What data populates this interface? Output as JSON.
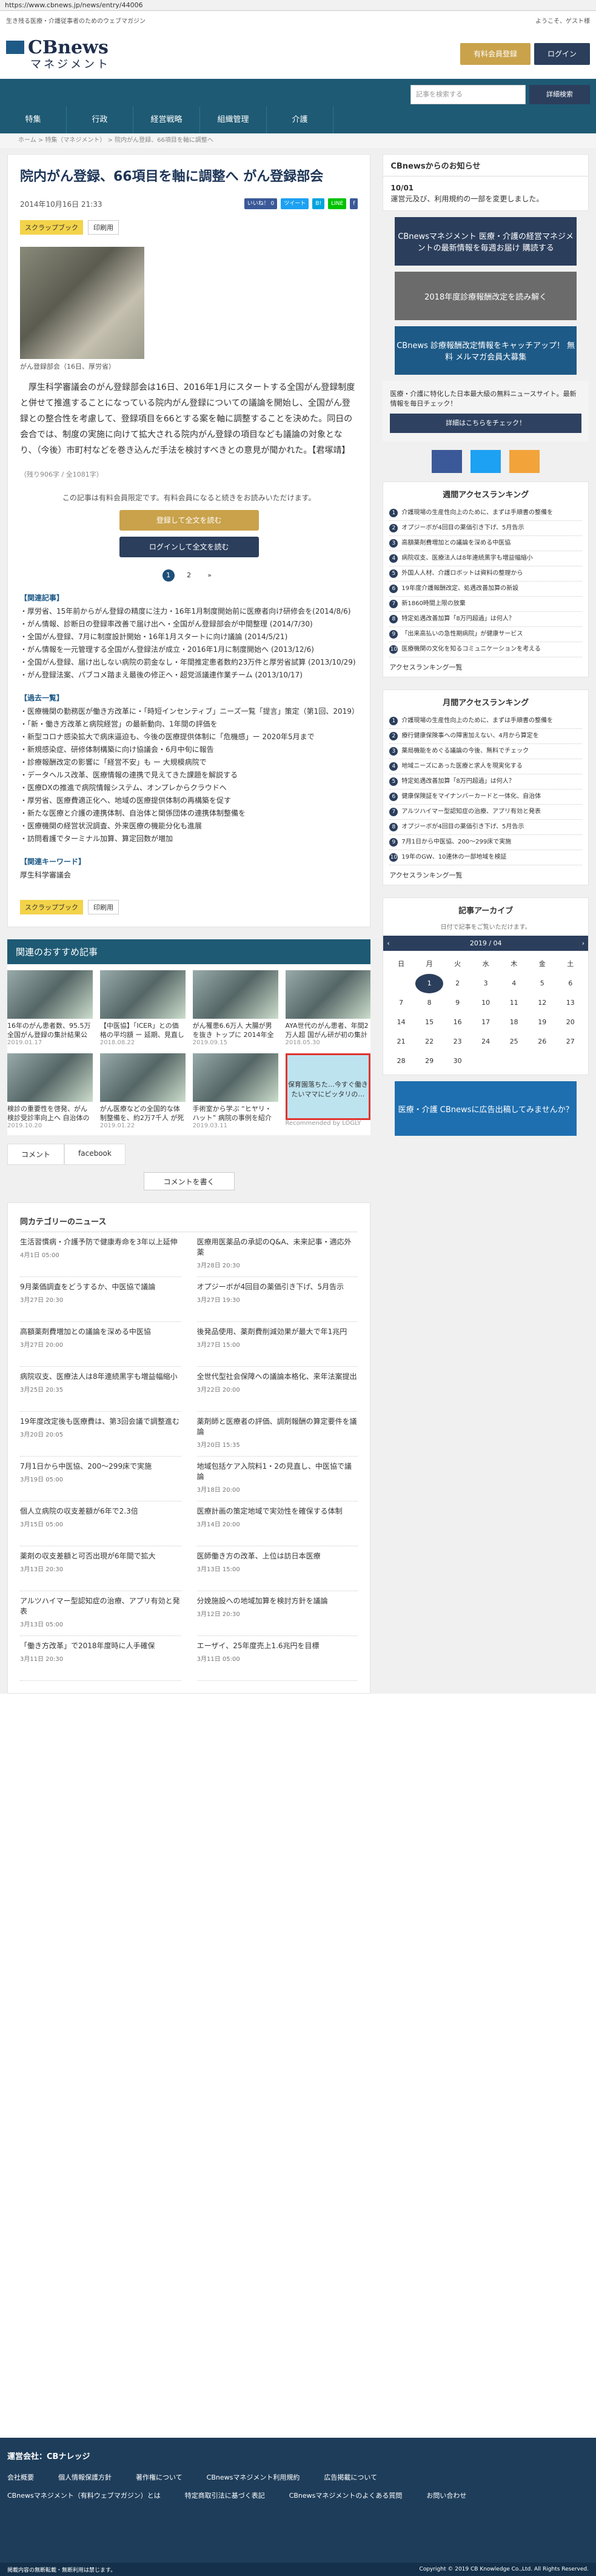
{
  "browser": {
    "url": "https://www.cbnews.jp/news/entry/44006"
  },
  "header": {
    "tagline": "生き残る医療・介護従事者のためのウェブマガジン",
    "welcome": "ようこそ、ゲスト様",
    "logo_main": "CBnews",
    "logo_sub": "マネジメント",
    "logo_small": "医療介護",
    "btn_subscribe": "有料会員登録",
    "btn_login": "ログイン"
  },
  "nav": {
    "search_placeholder": "記事を検索する",
    "search_button": "詳細検索",
    "tabs": [
      "特集",
      "行政",
      "経営戦略",
      "組織管理",
      "介護"
    ]
  },
  "breadcrumb": "ホーム > 特集（マネジメント） > 院内がん登録、66項目を軸に調整へ",
  "article": {
    "title": "院内がん登録、66項目を軸に調整へ がん登録部会",
    "date": "2014年10月16日 21:33",
    "share": [
      "いいね！ 0",
      "ツイート",
      "B!",
      "LINE",
      "f"
    ],
    "tag_scrap": "スクラップブック",
    "tag_print": "印刷用",
    "photo_caption": "がん登録部会（16日、厚労省）",
    "body": "厚生科学審議会のがん登録部会は16日、2016年1月にスタートする全国がん登録制度と併せて推進することになっている院内がん登録についての議論を開始し、全国がん登録との整合性を考慮して、登録項目を66とする案を軸に調整することを決めた。同日の会合では、制度の実施に向けて拡大される院内がん登録の項目なども議論の対象となり、（今後）市町村などを巻き込んだ手法を検討すべきとの意見が聞かれた。【君塚靖】",
    "char_count": "（残り906字 / 全1081字）",
    "paywall_text": "この記事は有料会員限定です。有料会員になると続きをお読みいただけます。",
    "btn_read": "登録して全文を読む",
    "btn_login_read": "ログインして全文を読む",
    "pages": [
      "1",
      "2",
      "»"
    ],
    "related_head": "【関連記事】",
    "related": [
      "・厚労省、15年前からがん登録の精度に注力・16年1月制度開始前に医療者向け研修会を(2014/8/6)",
      "・がん情報、診断日の登録率改善で届け出へ・全国がん登録部会が中間整理 (2014/7/30)",
      "・全国がん登録、7月に制度設計開始・16年1月スタートに向け議論 (2014/5/21)",
      "・がん情報を一元管理する全国がん登録法が成立・2016年1月に制度開始へ (2013/12/6)",
      "・全国がん登録、届け出しない病院の罰金なし・年間推定患者数約23万件と厚労省試算 (2013/10/29)",
      "・がん登録法案、パブコメ踏まえ最後の修正へ・超党派議連作業チーム (2013/10/17)"
    ],
    "popular_head": "【過去一覧】",
    "popular": [
      "・医療機関の勤務医が働き方改革に・「時短インセンティブ」ニーズ一覧「提言」策定（第1回、2019）",
      "・「新・働き方改革と病院経営」の最新動向、1年間の評価を",
      "・新型コロナ感染拡大で病床逼迫も、今後の医療提供体制に「危機感」ー 2020年5月まで",
      "・新規感染症、研修体制構築に向け協議会・6月中旬に報告",
      "・診療報酬改定の影響に「経営不安」も ー 大規模病院で",
      "・データヘルス改革、医療情報の連携で見えてきた課題を解説する",
      "・医療DXの推進で病院情報システム、オンプレからクラウドへ",
      "・厚労省、医療費適正化へ、地域の医療提供体制の再構築を促す",
      "・新たな医療と介護の連携体制、自治体と関係団体の連携体制整備を",
      "・医療機関の経営状況調査、外来医療の機能分化も進展",
      "・訪問看護でターミナル加算、算定回数が増加"
    ],
    "keyword_head": "【関連キーワード】",
    "keyword": "厚生科学審議会"
  },
  "recommend": {
    "head": "関連のおすすめ記事",
    "items": [
      {
        "title": "16年のがん患者数、95.5万 全国がん登録の集計結果公表",
        "date": "2019.01.17"
      },
      {
        "title": "【中医協】「ICER」との価格の平均額 ー 延期、見直し",
        "date": "2018.08.22"
      },
      {
        "title": "がん罹患6.6万人 大腸が男を抜き トップに 2014年全国推計",
        "date": "2019.09.15"
      },
      {
        "title": "AYA世代のがん患者、年間2万人超 国がん研が初の集計",
        "date": "2018.05.30"
      },
      {
        "title": "検診の重要性を啓発、がん検診受診率向上へ 自治体の先進事例",
        "date": "2019.10.20"
      },
      {
        "title": "がん医療などの全国的な体制整備を、約2万7千人 が死亡",
        "date": "2019.01.22"
      },
      {
        "title": "手術室から学ぶ “ヒヤリ・ハット” 病院の事例を紹介",
        "date": "2019.03.11"
      }
    ],
    "ad_text": "保育園落ちた…今すぐ働きたいママにピッタリの…",
    "ad_brand": "Recommended by LOGLY"
  },
  "comments": {
    "tab_comment": "コメント",
    "tab_facebook": "facebook",
    "btn_write": "コメントを書く"
  },
  "news": {
    "head": "同カテゴリーのニュース",
    "items": [
      {
        "title": "生活習慣病・介護予防で健康寿命を3年以上延伸",
        "date": "4月1日 05:00"
      },
      {
        "title": "医療用医薬品の承認のQ&A、未来記事・適応外薬",
        "date": "3月28日 20:30"
      },
      {
        "title": "9月薬価調査をどうするか、中医協で議論",
        "date": "3月27日 20:30"
      },
      {
        "title": "オプジーボが4回目の薬価引き下げ、5月告示",
        "date": "3月27日 19:30"
      },
      {
        "title": "高額薬剤費増加との議論を深める中医協",
        "date": "3月27日 20:00"
      },
      {
        "title": "後発品使用、薬剤費削減効果が最大で年1兆円",
        "date": "3月27日 15:00"
      },
      {
        "title": "病院収支、医療法人は8年連続黒字も増益幅縮小",
        "date": "3月25日 20:35"
      },
      {
        "title": "全世代型社会保障への議論本格化、来年法案提出",
        "date": "3月22日 20:00"
      },
      {
        "title": "19年度改定後も医療費は、第3回会議で調整進む",
        "date": "3月20日 20:05"
      },
      {
        "title": "薬剤師と医療者の評価、調剤報酬の算定要件を議論",
        "date": "3月20日 15:35"
      },
      {
        "title": "7月1日から中医協、200～299床で実施",
        "date": "3月19日 05:00"
      },
      {
        "title": "地域包括ケア入院料1・2の見直し、中医協で議論",
        "date": "3月18日 20:00"
      },
      {
        "title": "個人立病院の収支差額が6年で2.3倍",
        "date": "3月15日 05:00"
      },
      {
        "title": "医療計画の策定地域で実効性を確保する体制",
        "date": "3月14日 20:00"
      },
      {
        "title": "薬剤の収支差額と可否出現が6年間で拡大",
        "date": "3月13日 20:30"
      },
      {
        "title": "医師働き方の改革、上位は訪日本医療",
        "date": "3月13日 15:00"
      },
      {
        "title": "アルツハイマー型認知症の治療、アプリ有効と発表",
        "date": "3月13日 05:00"
      },
      {
        "title": "分娩施設への地域加算を検討方針を議論",
        "date": "3月12日 20:30"
      },
      {
        "title": "「働き方改革」で2018年度時に人手確保",
        "date": "3月11日 20:30"
      },
      {
        "title": "エーザイ、25年度売上1.6兆円を目標",
        "date": "3月11日 05:00"
      }
    ]
  },
  "sidebar": {
    "notice_head": "CBnewsからのお知らせ",
    "notice_date": "10/01",
    "notice_text": "運営元及び、利用規約の一部を変更しました。",
    "banner1": "CBnewsマネジメント 医療・介護の経営マネジメントの最新情報を毎週お届け 購読する",
    "banner2": "2018年度診療報酬改定を読み解く",
    "banner3": "CBnews 診療報酬改定情報をキャッチアップ！ 無料 メルマガ会員大募集",
    "cb_text": "医療・介護に特化した日本最大級の無料ニュースサイト。最新情報を毎日チェック！",
    "cb_btn": "詳細はこちらをチェック！",
    "weekly_head": "週間アクセスランキング",
    "weekly": [
      "介護現場の生産性向上のために、まずは手順書の整備を",
      "オプジーボが4回目の薬価引き下げ、5月告示",
      "高額薬剤費増加との議論を深める中医協",
      "病院収支、医療法人は8年連続黒字も増益幅縮小",
      "外国人人材、介護ロボットは資料の整理から",
      "19年度介護報酬改定、処遇改善加算の新設",
      "新1860時間上限の放棄",
      "特定処遇改善加算「8万円超過」は何人？",
      "「出来高払いの急性期病院」が健康サービス",
      "医療機関の文化を知るコミュニケーションを考える"
    ],
    "weekly_more": "アクセスランキング一覧",
    "monthly_head": "月間アクセスランキング",
    "monthly": [
      "介護現場の生産性向上のために、まずは手順書の整備を",
      "療行健康保険事への障害加えない、4月から算定を",
      "薬局機能をめぐる議論の今後、無料でチェック",
      "地域ニーズにあった医療と求人を現実化する",
      "特定処遇改善加算「8万円超過」は何人？",
      "健康保険証をマイナンバーカードと一体化、自治体",
      "アルツハイマー型認知症の治療、アプリ有効と発表",
      "オプジーボが4回目の薬価引き下げ、5月告示",
      "7月1日から中医協、200～299床で実施",
      "19年のGW、10連休の一部地域を検証"
    ],
    "monthly_more": "アクセスランキング一覧",
    "archive_head": "記事アーカイブ",
    "archive_sub": "日付で記事をご覧いただけます。",
    "cal_month": "2019 / 04",
    "cal_prev": "‹",
    "cal_next": "›",
    "cal_days": [
      "日",
      "月",
      "火",
      "水",
      "木",
      "金",
      "土"
    ],
    "cal_dates": [
      "",
      "1",
      "2",
      "3",
      "4",
      "5",
      "6",
      "7",
      "8",
      "9",
      "10",
      "11",
      "12",
      "13",
      "14",
      "15",
      "16",
      "17",
      "18",
      "19",
      "20",
      "21",
      "22",
      "23",
      "24",
      "25",
      "26",
      "27",
      "28",
      "29",
      "30",
      "",
      "",
      "",
      ""
    ],
    "ad_banner": "医療・介護 CBnewsに広告出稿してみませんか？"
  },
  "footer": {
    "company": "運営会社：CBナレッジ",
    "links": [
      "会社概要",
      "個人情報保護方針",
      "著作権について",
      "CBnewsマネジメント利用規約",
      "広告掲載について",
      "CBnewsマネジメント（有料ウェブマガジン）とは",
      "特定商取引法に基づく表記",
      "CBnewsマネジメントのよくある質問",
      "お問い合わせ"
    ],
    "copyright_left": "掲載内容の無断転載・無断利用は禁じます。",
    "copyright_right": "Copyright © 2019 CB Knowledge Co.,Ltd. All Rights Reserved."
  },
  "colors": {
    "navy": "#1e5a74",
    "dark_navy": "#2b3e5c",
    "gold": "#c9a24b",
    "red": "#e0342f"
  }
}
